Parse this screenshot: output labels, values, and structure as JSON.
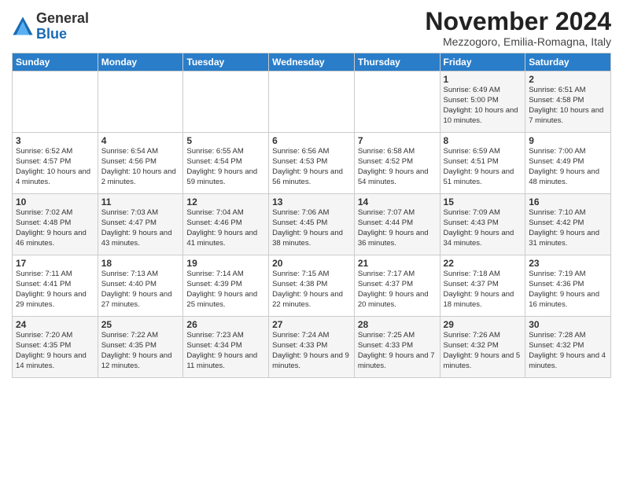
{
  "logo": {
    "general": "General",
    "blue": "Blue"
  },
  "header": {
    "month": "November 2024",
    "location": "Mezzogoro, Emilia-Romagna, Italy"
  },
  "days": [
    "Sunday",
    "Monday",
    "Tuesday",
    "Wednesday",
    "Thursday",
    "Friday",
    "Saturday"
  ],
  "weeks": [
    [
      {
        "day": "",
        "info": ""
      },
      {
        "day": "",
        "info": ""
      },
      {
        "day": "",
        "info": ""
      },
      {
        "day": "",
        "info": ""
      },
      {
        "day": "",
        "info": ""
      },
      {
        "day": "1",
        "info": "Sunrise: 6:49 AM\nSunset: 5:00 PM\nDaylight: 10 hours and 10 minutes."
      },
      {
        "day": "2",
        "info": "Sunrise: 6:51 AM\nSunset: 4:58 PM\nDaylight: 10 hours and 7 minutes."
      }
    ],
    [
      {
        "day": "3",
        "info": "Sunrise: 6:52 AM\nSunset: 4:57 PM\nDaylight: 10 hours and 4 minutes."
      },
      {
        "day": "4",
        "info": "Sunrise: 6:54 AM\nSunset: 4:56 PM\nDaylight: 10 hours and 2 minutes."
      },
      {
        "day": "5",
        "info": "Sunrise: 6:55 AM\nSunset: 4:54 PM\nDaylight: 9 hours and 59 minutes."
      },
      {
        "day": "6",
        "info": "Sunrise: 6:56 AM\nSunset: 4:53 PM\nDaylight: 9 hours and 56 minutes."
      },
      {
        "day": "7",
        "info": "Sunrise: 6:58 AM\nSunset: 4:52 PM\nDaylight: 9 hours and 54 minutes."
      },
      {
        "day": "8",
        "info": "Sunrise: 6:59 AM\nSunset: 4:51 PM\nDaylight: 9 hours and 51 minutes."
      },
      {
        "day": "9",
        "info": "Sunrise: 7:00 AM\nSunset: 4:49 PM\nDaylight: 9 hours and 48 minutes."
      }
    ],
    [
      {
        "day": "10",
        "info": "Sunrise: 7:02 AM\nSunset: 4:48 PM\nDaylight: 9 hours and 46 minutes."
      },
      {
        "day": "11",
        "info": "Sunrise: 7:03 AM\nSunset: 4:47 PM\nDaylight: 9 hours and 43 minutes."
      },
      {
        "day": "12",
        "info": "Sunrise: 7:04 AM\nSunset: 4:46 PM\nDaylight: 9 hours and 41 minutes."
      },
      {
        "day": "13",
        "info": "Sunrise: 7:06 AM\nSunset: 4:45 PM\nDaylight: 9 hours and 38 minutes."
      },
      {
        "day": "14",
        "info": "Sunrise: 7:07 AM\nSunset: 4:44 PM\nDaylight: 9 hours and 36 minutes."
      },
      {
        "day": "15",
        "info": "Sunrise: 7:09 AM\nSunset: 4:43 PM\nDaylight: 9 hours and 34 minutes."
      },
      {
        "day": "16",
        "info": "Sunrise: 7:10 AM\nSunset: 4:42 PM\nDaylight: 9 hours and 31 minutes."
      }
    ],
    [
      {
        "day": "17",
        "info": "Sunrise: 7:11 AM\nSunset: 4:41 PM\nDaylight: 9 hours and 29 minutes."
      },
      {
        "day": "18",
        "info": "Sunrise: 7:13 AM\nSunset: 4:40 PM\nDaylight: 9 hours and 27 minutes."
      },
      {
        "day": "19",
        "info": "Sunrise: 7:14 AM\nSunset: 4:39 PM\nDaylight: 9 hours and 25 minutes."
      },
      {
        "day": "20",
        "info": "Sunrise: 7:15 AM\nSunset: 4:38 PM\nDaylight: 9 hours and 22 minutes."
      },
      {
        "day": "21",
        "info": "Sunrise: 7:17 AM\nSunset: 4:37 PM\nDaylight: 9 hours and 20 minutes."
      },
      {
        "day": "22",
        "info": "Sunrise: 7:18 AM\nSunset: 4:37 PM\nDaylight: 9 hours and 18 minutes."
      },
      {
        "day": "23",
        "info": "Sunrise: 7:19 AM\nSunset: 4:36 PM\nDaylight: 9 hours and 16 minutes."
      }
    ],
    [
      {
        "day": "24",
        "info": "Sunrise: 7:20 AM\nSunset: 4:35 PM\nDaylight: 9 hours and 14 minutes."
      },
      {
        "day": "25",
        "info": "Sunrise: 7:22 AM\nSunset: 4:35 PM\nDaylight: 9 hours and 12 minutes."
      },
      {
        "day": "26",
        "info": "Sunrise: 7:23 AM\nSunset: 4:34 PM\nDaylight: 9 hours and 11 minutes."
      },
      {
        "day": "27",
        "info": "Sunrise: 7:24 AM\nSunset: 4:33 PM\nDaylight: 9 hours and 9 minutes."
      },
      {
        "day": "28",
        "info": "Sunrise: 7:25 AM\nSunset: 4:33 PM\nDaylight: 9 hours and 7 minutes."
      },
      {
        "day": "29",
        "info": "Sunrise: 7:26 AM\nSunset: 4:32 PM\nDaylight: 9 hours and 5 minutes."
      },
      {
        "day": "30",
        "info": "Sunrise: 7:28 AM\nSunset: 4:32 PM\nDaylight: 9 hours and 4 minutes."
      }
    ]
  ]
}
